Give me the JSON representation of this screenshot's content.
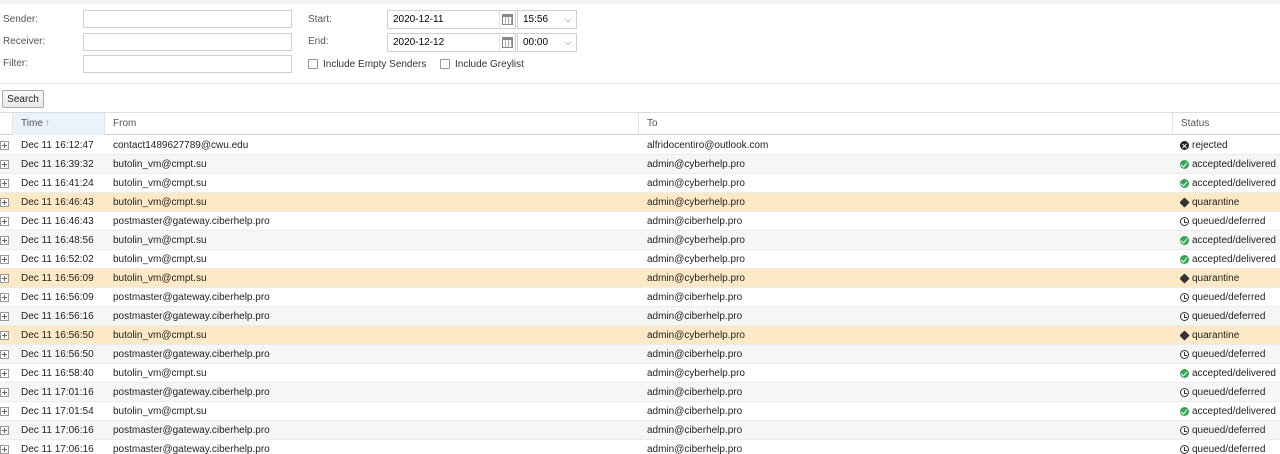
{
  "filters": {
    "sender_label": "Sender:",
    "sender_value": "",
    "receiver_label": "Receiver:",
    "receiver_value": "",
    "filter_label": "Filter:",
    "filter_value": "",
    "start_label": "Start:",
    "start_date": "2020-12-11",
    "start_time": "15:56",
    "end_label": "End:",
    "end_date": "2020-12-12",
    "end_time": "00:00",
    "include_empty_senders_label": "Include Empty Senders",
    "include_empty_senders_checked": false,
    "include_greylist_label": "Include Greylist",
    "include_greylist_checked": false,
    "search_label": "Search"
  },
  "grid": {
    "columns": {
      "time": "Time",
      "from": "From",
      "to": "To",
      "status": "Status"
    },
    "sort_arrow": "↑",
    "rows": [
      {
        "time": "Dec 11 16:12:47",
        "from": "contact1489627789@cwu.edu",
        "to": "alfridocentiro@outlook.com",
        "status": "rejected",
        "icon": "rejected-icon",
        "highlight": false
      },
      {
        "time": "Dec 11 16:39:32",
        "from": "butolin_vm@cmpt.su",
        "to": "admin@cyberhelp.pro",
        "status": "accepted/delivered",
        "icon": "check-circle-icon",
        "highlight": false
      },
      {
        "time": "Dec 11 16:41:24",
        "from": "butolin_vm@cmpt.su",
        "to": "admin@cyberhelp.pro",
        "status": "accepted/delivered",
        "icon": "check-circle-icon",
        "highlight": false
      },
      {
        "time": "Dec 11 16:46:43",
        "from": "butolin_vm@cmpt.su",
        "to": "admin@cyberhelp.pro",
        "status": "quarantine",
        "icon": "cube-icon",
        "highlight": true
      },
      {
        "time": "Dec 11 16:46:43",
        "from": "postmaster@gateway.ciberhelp.pro",
        "to": "admin@ciberhelp.pro",
        "status": "queued/deferred",
        "icon": "clock-icon",
        "highlight": false
      },
      {
        "time": "Dec 11 16:48:56",
        "from": "butolin_vm@cmpt.su",
        "to": "admin@cyberhelp.pro",
        "status": "accepted/delivered",
        "icon": "check-circle-icon",
        "highlight": false
      },
      {
        "time": "Dec 11 16:52:02",
        "from": "butolin_vm@cmpt.su",
        "to": "admin@cyberhelp.pro",
        "status": "accepted/delivered",
        "icon": "check-circle-icon",
        "highlight": false
      },
      {
        "time": "Dec 11 16:56:09",
        "from": "butolin_vm@cmpt.su",
        "to": "admin@cyberhelp.pro",
        "status": "quarantine",
        "icon": "cube-icon",
        "highlight": true
      },
      {
        "time": "Dec 11 16:56:09",
        "from": "postmaster@gateway.ciberhelp.pro",
        "to": "admin@ciberhelp.pro",
        "status": "queued/deferred",
        "icon": "clock-icon",
        "highlight": false
      },
      {
        "time": "Dec 11 16:56:16",
        "from": "postmaster@gateway.ciberhelp.pro",
        "to": "admin@ciberhelp.pro",
        "status": "queued/deferred",
        "icon": "clock-icon",
        "highlight": false
      },
      {
        "time": "Dec 11 16:56:50",
        "from": "butolin_vm@cmpt.su",
        "to": "admin@cyberhelp.pro",
        "status": "quarantine",
        "icon": "cube-icon",
        "highlight": true
      },
      {
        "time": "Dec 11 16:56:50",
        "from": "postmaster@gateway.ciberhelp.pro",
        "to": "admin@ciberhelp.pro",
        "status": "queued/deferred",
        "icon": "clock-icon",
        "highlight": false
      },
      {
        "time": "Dec 11 16:58:40",
        "from": "butolin_vm@cmpt.su",
        "to": "admin@cyberhelp.pro",
        "status": "accepted/delivered",
        "icon": "check-circle-icon",
        "highlight": false
      },
      {
        "time": "Dec 11 17:01:16",
        "from": "postmaster@gateway.ciberhelp.pro",
        "to": "admin@ciberhelp.pro",
        "status": "queued/deferred",
        "icon": "clock-icon",
        "highlight": false
      },
      {
        "time": "Dec 11 17:01:54",
        "from": "butolin_vm@cmpt.su",
        "to": "admin@ciberhelp.pro",
        "status": "accepted/delivered",
        "icon": "check-circle-icon",
        "highlight": false
      },
      {
        "time": "Dec 11 17:06:16",
        "from": "postmaster@gateway.ciberhelp.pro",
        "to": "admin@ciberhelp.pro",
        "status": "queued/deferred",
        "icon": "clock-icon",
        "highlight": false
      },
      {
        "time": "Dec 11 17:06:16",
        "from": "postmaster@gateway.ciberhelp.pro",
        "to": "admin@ciberhelp.pro",
        "status": "queued/deferred",
        "icon": "clock-icon",
        "highlight": false
      }
    ]
  },
  "colors": {
    "highlight_row": "#fde9c6",
    "accepted": "#2fa84f",
    "sorted_header": "#eaf2fb"
  }
}
